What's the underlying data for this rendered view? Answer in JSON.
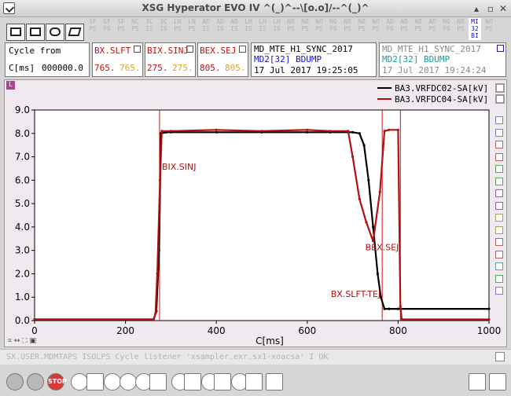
{
  "window": {
    "title": "XSG Hyperator EVO IV  ^(_)^--\\[o.o]/--^(_)^"
  },
  "toolbar": {
    "buttons": [
      "display-icon",
      "table-icon",
      "bike-icon",
      "edit-icon"
    ]
  },
  "status_grid": {
    "columns": [
      [
        "SF",
        "PS"
      ],
      [
        "SF",
        "PS"
      ],
      [
        "SF",
        "PS"
      ],
      [
        "NC",
        "PS"
      ],
      [
        "3C",
        "IS"
      ],
      [
        "3C",
        "IS"
      ],
      [
        "LN",
        "PS"
      ],
      [
        "LN",
        "PS"
      ],
      [
        "AD",
        "IS"
      ],
      [
        "AD",
        "IS"
      ],
      [
        "AD",
        "IS"
      ],
      [
        "LH",
        "IS"
      ],
      [
        "LH",
        "IS"
      ],
      [
        "LH",
        "IS"
      ],
      [
        "NO",
        "PS"
      ],
      [
        "NO",
        "PS"
      ],
      [
        "NO",
        "PS"
      ],
      [
        "NO",
        "PS"
      ],
      [
        "NO",
        "PS"
      ],
      [
        "NO",
        "PS"
      ],
      [
        "NO",
        "PS"
      ],
      [
        "AD",
        "PS"
      ],
      [
        "AD",
        "PS"
      ],
      [
        "AD",
        "PS"
      ],
      [
        "AD",
        "PS"
      ],
      [
        "NO",
        "PS"
      ],
      [
        "NO",
        "PS"
      ],
      [
        "MI",
        "32",
        "BI"
      ],
      [
        "NO",
        "PS"
      ]
    ],
    "selected_index": 27
  },
  "cycle": {
    "label": "Cycle from",
    "c_label": "C[ms]",
    "c_value": "000000.0"
  },
  "blm_panels": [
    {
      "name": "BX.SLFT",
      "v1": "765.",
      "v2": "765."
    },
    {
      "name": "BIX.SINJ",
      "v1": "275.",
      "v2": "275."
    },
    {
      "name": "BEX.SEJ",
      "v1": "805.",
      "v2": "805."
    }
  ],
  "sync_left": {
    "line1": "MD_MTE_H1_SYNC_2017",
    "line2": "MD2[32] BDUMP",
    "line3": "17 Jul 2017 19:25:05"
  },
  "sync_right": {
    "line1": "MD_MTE_H1_SYNC_2017",
    "line2": "MD2[32] BDUMP",
    "line3": "17 Jul 2017 19:24:24"
  },
  "plot": {
    "corner_label": "L",
    "toolbar_text": "⌗ ↔ ⛶ ▣",
    "side_icons": [
      "#8080c0",
      "#8080c0",
      "#c06060",
      "#c06060",
      "#60a060",
      "#60a060",
      "#a060a0",
      "#a060a0",
      "#a0a060",
      "#a0a060",
      "#c06060",
      "#c06060",
      "#60a0a0",
      "#60a060",
      "#8080c0"
    ]
  },
  "statusbar": {
    "message": "SX.USER.MDMTAPS ISOLPS Cycle listener 'xsampler.exr.sx1-xoacsa' I OK"
  },
  "chart_data": {
    "type": "line",
    "xlabel": "C[ms]",
    "ylabel": "",
    "xlim": [
      0,
      1000
    ],
    "ylim": [
      0,
      9
    ],
    "xticks": [
      0,
      200,
      400,
      600,
      800,
      1000
    ],
    "yticks": [
      0.0,
      1.0,
      2.0,
      3.0,
      4.0,
      5.0,
      6.0,
      7.0,
      8.0,
      9.0
    ],
    "grid": false,
    "legend_position": "top-right",
    "series": [
      {
        "name": "BA3.VRFDC02-SA[kV]",
        "color": "#000000",
        "x": [
          0,
          262,
          268,
          274,
          278,
          290,
          300,
          400,
          500,
          600,
          650,
          700,
          715,
          725,
          735,
          745,
          755,
          762,
          770,
          780,
          800,
          1000
        ],
        "y": [
          0.05,
          0.05,
          0.4,
          3.0,
          8.0,
          8.05,
          8.05,
          8.05,
          8.05,
          8.05,
          8.05,
          8.05,
          8.0,
          7.5,
          6.0,
          4.0,
          2.0,
          1.0,
          0.5,
          0.5,
          0.5,
          0.5
        ]
      },
      {
        "name": "BA3.VRFDC04-SA[kV]",
        "color": "#b01010",
        "x": [
          0,
          262,
          266,
          270,
          276,
          280,
          300,
          400,
          500,
          600,
          650,
          690,
          700,
          715,
          730,
          745,
          760,
          770,
          780,
          800,
          805,
          808,
          1000
        ],
        "y": [
          0.05,
          0.05,
          0.3,
          2.0,
          6.0,
          8.1,
          8.1,
          8.15,
          8.1,
          8.15,
          8.1,
          8.1,
          7.0,
          5.2,
          4.2,
          3.4,
          5.5,
          8.1,
          8.15,
          8.15,
          0.6,
          0.05,
          0.05
        ]
      }
    ],
    "markers": [
      {
        "label": "BIX.SINJ",
        "x": 275,
        "label_y": 6.45
      },
      {
        "label": "BEX.SEJ",
        "x": 805,
        "label_y": 3.0
      },
      {
        "label": "BX.SLFT-TEJ",
        "x": 765,
        "label_y": 1.0
      }
    ]
  }
}
